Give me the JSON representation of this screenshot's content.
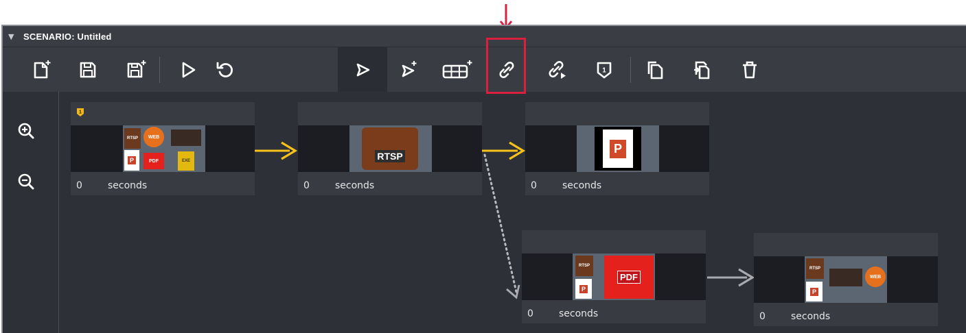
{
  "window": {
    "title": "SCENARIO: Untitled",
    "collapse_glyph": "▼"
  },
  "toolbar": {
    "buttons": [
      {
        "name": "new-scenario-button",
        "icon": "new-file-plus-icon"
      },
      {
        "name": "save-button",
        "icon": "floppy-icon"
      },
      {
        "name": "save-as-button",
        "icon": "floppy-plus-icon"
      },
      {
        "name": "play-button",
        "icon": "play-outline-icon"
      },
      {
        "name": "reset-button",
        "icon": "undo-icon"
      },
      {
        "name": "select-tool-button",
        "icon": "cursor-icon",
        "selected": true
      },
      {
        "name": "add-node-tool-button",
        "icon": "cursor-plus-icon"
      },
      {
        "name": "add-grid-node-button",
        "icon": "grid-plus-icon"
      },
      {
        "name": "link-tool-button",
        "icon": "link-icon",
        "highlighted": true
      },
      {
        "name": "link-play-tool-button",
        "icon": "link-play-icon"
      },
      {
        "name": "set-start-button",
        "icon": "shield-number-icon"
      },
      {
        "name": "copy-button",
        "icon": "copy-icon"
      },
      {
        "name": "paste-button",
        "icon": "paste-icon"
      },
      {
        "name": "delete-button",
        "icon": "trash-icon"
      }
    ],
    "start_badge_number": "1"
  },
  "zoom": {
    "zoom_in_icon": "zoom-in-icon",
    "zoom_out_icon": "zoom-out-icon"
  },
  "nodes": [
    {
      "id": "node-1",
      "duration": "0",
      "unit": "seconds",
      "start_badge": "1",
      "media": [
        "RTSP",
        "WEB",
        "image",
        "P",
        "PDF",
        "EXE"
      ]
    },
    {
      "id": "node-2",
      "duration": "0",
      "unit": "seconds",
      "media": [
        "RTSP"
      ]
    },
    {
      "id": "node-3",
      "duration": "0",
      "unit": "seconds",
      "media": [
        "P"
      ]
    },
    {
      "id": "node-4",
      "duration": "0",
      "unit": "seconds",
      "media": [
        "RTSP",
        "P",
        "PDF"
      ]
    },
    {
      "id": "node-5",
      "duration": "0",
      "unit": "seconds",
      "media": [
        "RTSP",
        "image",
        "WEB",
        "P"
      ]
    }
  ],
  "colors": {
    "link_primary": "#f7c21a",
    "link_secondary": "#a9aaad",
    "highlight": "#d9203f",
    "badge": "#f0b81c"
  }
}
